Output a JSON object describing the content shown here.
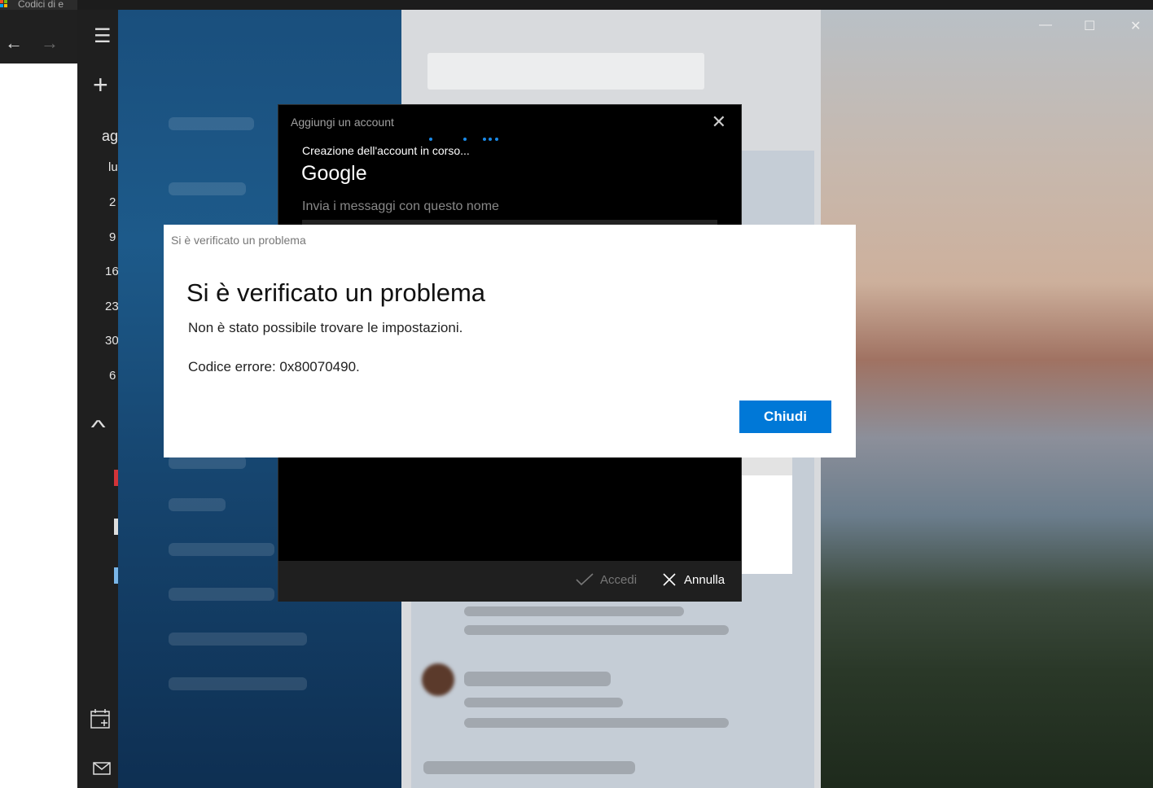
{
  "browser": {
    "tab_title": "Codici di e",
    "back_glyph": "←",
    "forward_glyph": "→"
  },
  "rail": {
    "menu_glyph": "☰",
    "add_glyph": "+",
    "month_label": "ag",
    "weekday_label": "lu",
    "dates": [
      "2",
      "9",
      "16",
      "23",
      "30",
      "6"
    ],
    "collapse_glyph": "^"
  },
  "window_controls": {
    "minimize": "—",
    "maximize": "☐",
    "close": "✕"
  },
  "account_dialog": {
    "title": "Aggiungi un account",
    "close_glyph": "✕",
    "status": "Creazione dell'account in corso...",
    "provider": "Google",
    "send_name_label": "Invia i messaggi con questo nome",
    "accedi_label": "Accedi",
    "annulla_label": "Annulla"
  },
  "error_dialog": {
    "caption": "Si è verificato un problema",
    "heading": "Si è verificato un problema",
    "message": "Non è stato possibile trovare le impostazioni.",
    "error_code": "Codice errore: 0x80070490.",
    "close_button": "Chiudi"
  },
  "colors": {
    "accent": "#0078d7",
    "dialog_dark": "#000000",
    "progress_dots": "#1a8ae8"
  }
}
